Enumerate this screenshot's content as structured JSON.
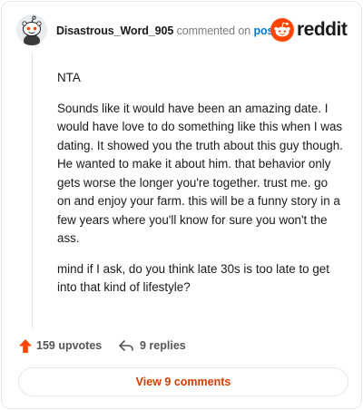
{
  "header": {
    "username": "Disastrous_Word_905",
    "verb": "commented on",
    "post_link": "post",
    "logo_text": "reddit",
    "brand_color": "#ff4500"
  },
  "comment": {
    "paragraphs": [
      "NTA",
      "Sounds like it would have been an amazing date. I would have love to do something like this when I was dating. It showed you the truth about this guy though. He wanted to make it about him. that behavior only gets worse the longer you're together. trust me. go on and enjoy your farm. this will be a funny story in a few years where you'll know for sure you won't the ass.",
      "mind if I ask, do you think late 30s is too late to get into that kind of lifestyle?"
    ]
  },
  "actions": {
    "upvotes_label": "159 upvotes",
    "replies_label": "9 replies",
    "upvote_icon": "upvote-arrow-icon",
    "reply_icon": "reply-arrow-icon"
  },
  "footer": {
    "view_comments_label": "View 9 comments",
    "accent_color": "#d93a00"
  }
}
